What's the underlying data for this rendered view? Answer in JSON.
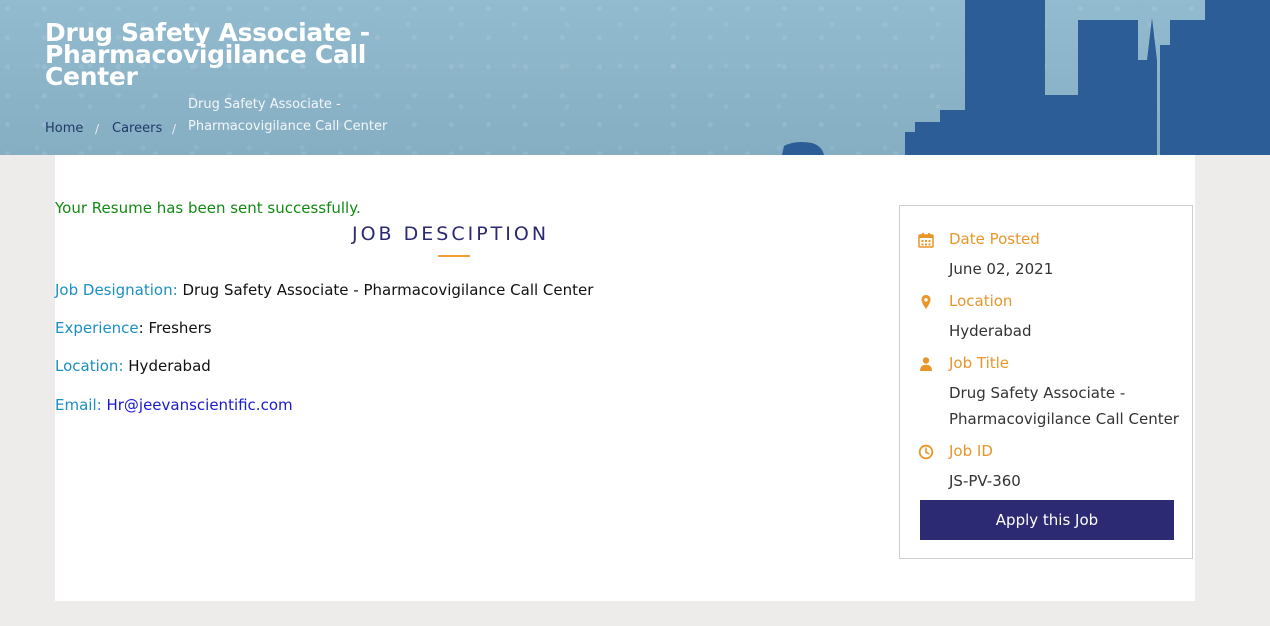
{
  "header": {
    "title": "Drug Safety Associate - Pharmacovigilance Call Center",
    "breadcrumb": {
      "home": "Home",
      "careers": "Careers",
      "separator": "/",
      "current": "Drug Safety Associate - Pharmacovigilance Call Center"
    }
  },
  "main": {
    "success_message": "Your Resume has been sent successfully.",
    "section_title": "JOB DESCIPTION",
    "details": {
      "designation_label": "Job Designation:",
      "designation_value": "Drug Safety Associate - Pharmacovigilance Call Center",
      "experience_label": "Experience",
      "experience_value": ": Freshers",
      "location_label": "Location:",
      "location_value": "Hyderabad",
      "email_label": "Email:",
      "email_value": "Hr@jeevanscientific.com"
    }
  },
  "sidebar": {
    "date_posted_label": "Date Posted",
    "date_posted_value": "June 02, 2021",
    "location_label": "Location",
    "location_value": "Hyderabad",
    "job_title_label": "Job Title",
    "job_title_value": "Drug Safety Associate - Pharmacovigilance Call Center",
    "job_id_label": "Job ID",
    "job_id_value": "JS-PV-360",
    "apply_label": "Apply this Job"
  },
  "colors": {
    "accent_orange": "#e8962a",
    "brand_navy": "#2b2a72",
    "label_blue": "#1c8fc4",
    "success_green": "#138a13",
    "banner_blue": "#8bb3c7",
    "skyline_blue": "#2c5d97"
  },
  "icons": {
    "date_posted": "calendar-icon",
    "location": "map-pin-icon",
    "job_title": "user-icon",
    "job_id": "clock-icon"
  }
}
